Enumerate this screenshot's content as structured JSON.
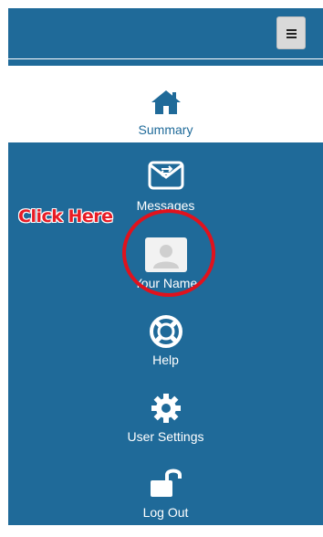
{
  "header": {
    "menu_button": "hamburger-menu"
  },
  "nav": {
    "summary": {
      "label": "Summary",
      "icon": "home-icon"
    },
    "messages": {
      "label": "Messages",
      "icon": "envelope-icon"
    },
    "profile": {
      "label": "Your Name",
      "icon": "avatar-icon"
    },
    "help": {
      "label": "Help",
      "icon": "lifebuoy-icon"
    },
    "settings": {
      "label": "User Settings",
      "icon": "gear-icon"
    },
    "logout": {
      "label": "Log Out",
      "icon": "unlock-icon"
    }
  },
  "annotation": {
    "callout": "Click Here"
  },
  "colors": {
    "brand_blue": "#1f6a99",
    "highlight_red": "#e0121d"
  }
}
